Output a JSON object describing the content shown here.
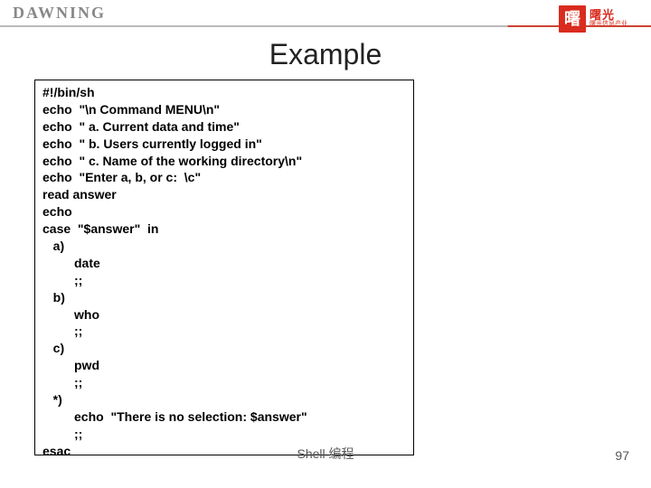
{
  "header": {
    "brand_left": "DAWNING",
    "logo_glyph": "曙",
    "logo_text1": "曙光",
    "logo_text2": "曙光信息产业"
  },
  "title": "Example",
  "code": {
    "l01": "#!/bin/sh",
    "l02": "echo  \"\\n Command MENU\\n\"",
    "l03": "echo  \" a. Current data and time\"",
    "l04": "echo  \" b. Users currently logged in\"",
    "l05": "echo  \" c. Name of the working directory\\n\"",
    "l06": "echo  \"Enter a, b, or c:  \\c\"",
    "l07": "read answer",
    "l08": "echo",
    "l09": "case  \"$answer\"  in",
    "l10": "   a)",
    "l11": "         date",
    "l12": "         ;;",
    "l13": "   b)",
    "l14": "         who",
    "l15": "         ;;",
    "l16": "   c)",
    "l17": "         pwd",
    "l18": "         ;;",
    "l19": "   *)",
    "l20": "         echo  \"There is no selection: $answer\"",
    "l21": "         ;;",
    "l22": "esac"
  },
  "footer": {
    "center": "Shell 编程",
    "page": "97"
  }
}
